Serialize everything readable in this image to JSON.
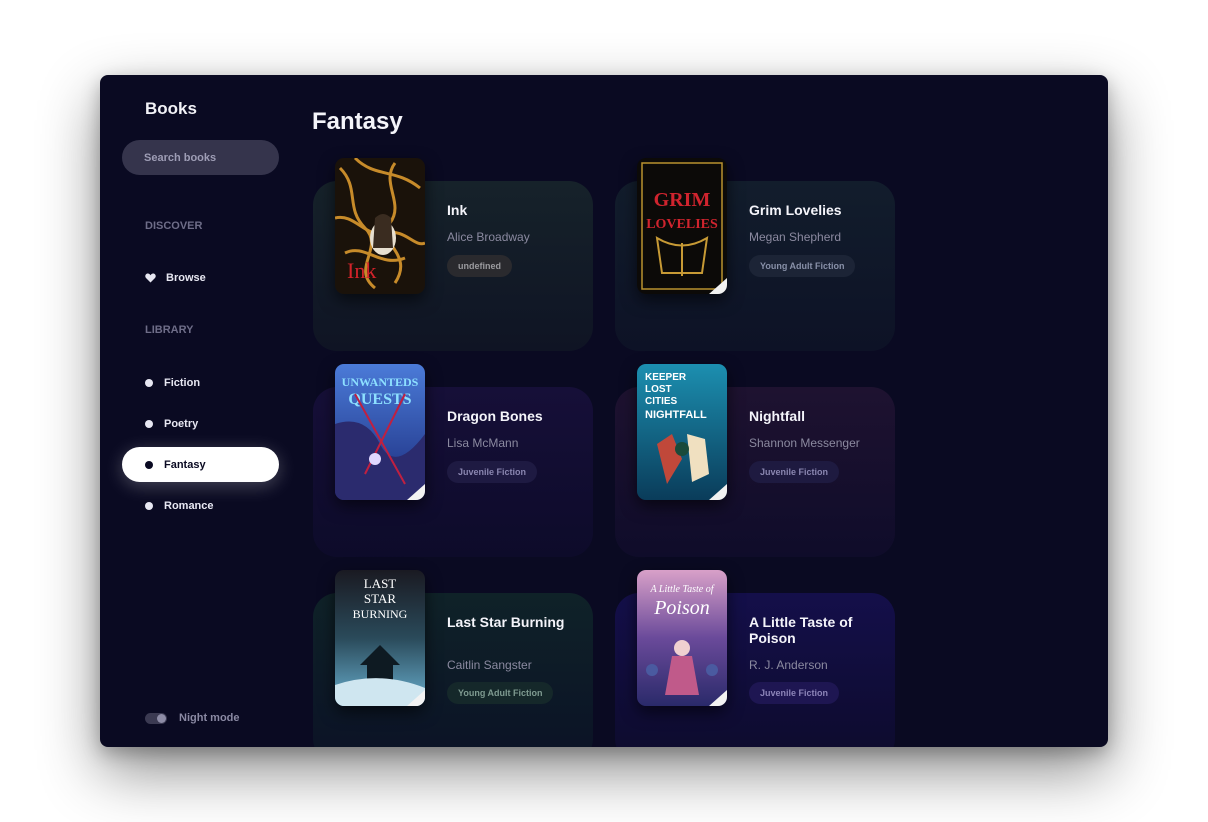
{
  "sidebar": {
    "brand": "Books",
    "search_placeholder": "Search books",
    "discover_label": "DISCOVER",
    "browse_label": "Browse",
    "library_label": "LIBRARY",
    "library_items": [
      {
        "label": "Fiction",
        "active": false
      },
      {
        "label": "Poetry",
        "active": false
      },
      {
        "label": "Fantasy",
        "active": true
      },
      {
        "label": "Romance",
        "active": false
      }
    ],
    "night_mode_label": "Night mode"
  },
  "main": {
    "title": "Fantasy",
    "books": [
      {
        "title": "Ink",
        "author": "Alice Broadway",
        "tag": "undefined",
        "cover_text": "Ink",
        "cover_subtext": "ALICE BROADWAY",
        "card_color": "#16202a",
        "tag_bg": "#2a2a2e",
        "tag_fg": "#9a9a9e"
      },
      {
        "title": "Grim Lovelies",
        "author": "Megan Shepherd",
        "tag": "Young Adult Fiction",
        "cover_text": "GRIM LOVELIES",
        "cover_subtext": "MEGAN SHEPHERD",
        "card_color": "#121a2a",
        "tag_bg": "#1c2436",
        "tag_fg": "#8890a8"
      },
      {
        "title": "Dragon Bones",
        "author": "Lisa McMann",
        "tag": "Juvenile Fiction",
        "cover_text": "UNWANTEDS QUESTS",
        "cover_subtext": "Dragon Bones",
        "card_color": "#140f34",
        "tag_bg": "#1e1a42",
        "tag_fg": "#8a86b0"
      },
      {
        "title": "Nightfall",
        "author": "Shannon Messenger",
        "tag": "Juvenile Fiction",
        "cover_text": "KEEPER LOST CITIES NIGHTFALL",
        "cover_subtext": "",
        "card_color": "#1c1230",
        "tag_bg": "#1e1a40",
        "tag_fg": "#8a86b0"
      },
      {
        "title": "Last Star Burning",
        "author": "Caitlin Sangster",
        "tag": "Young Adult Fiction",
        "cover_text": "LAST STAR BURNING",
        "cover_subtext": "CAITLIN SANGSTER",
        "card_color": "#0f2026",
        "tag_bg": "#15282a",
        "tag_fg": "#7e9a90"
      },
      {
        "title": "A Little Taste of Poison",
        "author": "R. J. Anderson",
        "tag": "Juvenile Fiction",
        "cover_text": "A Little Taste of Poison",
        "cover_subtext": "R.J. Anderson",
        "card_color": "#120e44",
        "tag_bg": "#1e1652",
        "tag_fg": "#8c84b8"
      }
    ]
  },
  "colors": {
    "background": "#0a0a22",
    "active_nav": "#ffffff",
    "text_primary": "#f4f4fa",
    "text_secondary": "#8b8aa0"
  }
}
